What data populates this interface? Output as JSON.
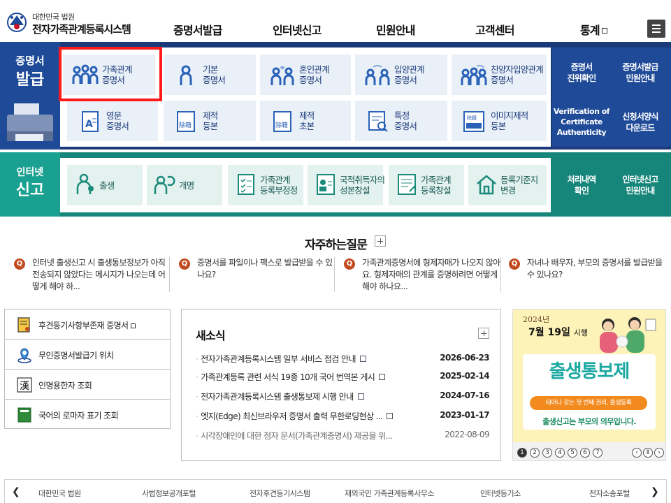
{
  "header": {
    "org": "대한민국 법원",
    "site_title": "전자가족관계등록시스템",
    "nav": [
      "증명서발급",
      "인터넷신고",
      "민원안내",
      "고객센터",
      "통계"
    ]
  },
  "issuance": {
    "title_top": "증명서",
    "title_bottom": "발급",
    "cards": [
      {
        "label": "가족관계\n증명서",
        "icon": "family-icon"
      },
      {
        "label": "기본\n증명서",
        "icon": "person-icon"
      },
      {
        "label": "혼인관계\n증명서",
        "icon": "couple-heart-icon"
      },
      {
        "label": "입양관계\n증명서",
        "icon": "adoption-icon"
      },
      {
        "label": "친양자입양관계\n증명서",
        "icon": "family-adoption-icon"
      },
      {
        "label": "영문\n증명서",
        "icon": "english-doc-icon"
      },
      {
        "label": "제적\n등본",
        "icon": "removed-record-icon"
      },
      {
        "label": "제적\n초본",
        "icon": "removed-record-icon"
      },
      {
        "label": "특정\n증명서",
        "icon": "search-doc-icon"
      },
      {
        "label": "이미지제적\n등본",
        "icon": "image-record-icon"
      }
    ],
    "side": [
      "증명서\n진위확인",
      "증명서발급\n민원안내",
      "Verification of\nCertificate\nAuthenticity",
      "신청서양식\n다운로드"
    ]
  },
  "report": {
    "title_top": "인터넷",
    "title_bottom": "신고",
    "cards": [
      {
        "label": "출생",
        "icon": "birth-icon"
      },
      {
        "label": "개명",
        "icon": "rename-icon"
      },
      {
        "label": "가족관계\n등록부정정",
        "icon": "checklist-icon"
      },
      {
        "label": "국적취득자의\n성본창설",
        "icon": "id-card-icon"
      },
      {
        "label": "가족관계\n등록창설",
        "icon": "create-doc-icon"
      },
      {
        "label": "등록기준지\n변경",
        "icon": "house-icon"
      }
    ],
    "side": [
      "처리내역\n확인",
      "인터넷신고\n민원안내"
    ]
  },
  "faq": {
    "title": "자주하는질문",
    "items": [
      "인터넷 출생신고 시 출생통보정보가 아직 전송되지 않았다는 메시지가 나오는데 어떻게 해야 하...",
      "증명서를 파일이나 팩스로 발급받을 수 있나요?",
      "가족관계증명서에 형제자매가 나오지 않아요. 형제자매의 관계를 증명하려면 어떻게 해야 하나요...",
      "자녀나 배우자, 부모의 증명서를 발급받을 수 있나요?"
    ]
  },
  "quick_links": [
    {
      "label": "후견등기사항부존재 증명서",
      "icon": "certificate-icon",
      "external": true
    },
    {
      "label": "무인증명서발급기 위치",
      "icon": "location-pin-icon",
      "external": false
    },
    {
      "label": "인명용한자 조회",
      "icon": "hanja-icon",
      "external": false
    },
    {
      "label": "국어의 로마자 표기 조회",
      "icon": "book-icon",
      "external": false
    }
  ],
  "news": {
    "title": "새소식",
    "items": [
      {
        "title": "전자가족관계등록시스템 일부 서비스 점검 안내",
        "date": "2026-06-23",
        "attach": true
      },
      {
        "title": "가족관계등록 관련 서식 19종 10개 국어 번역본 게시",
        "date": "2025-02-14",
        "attach": true
      },
      {
        "title": "전자가족관계등록시스템 출생통보제 시행 안내",
        "date": "2024-07-16",
        "attach": true
      },
      {
        "title": "엣지(Edge) 최신브라우저 증명서 출력 무한로딩현상 ...",
        "date": "2023-01-17",
        "attach": true
      },
      {
        "title": "시각장애인에 대한 점자 문서(가족관계증명서) 제공을 위...",
        "date": "2022-08-09",
        "attach": false
      }
    ]
  },
  "banner": {
    "year": "2024년",
    "date": "7월 19일",
    "date_suffix": "시행",
    "headline": "출생통보제",
    "ribbon": "태어나 갖는 첫 번째 권리, 출생등록",
    "footer": "출생신고는 부모의 의무입니다.",
    "pages": [
      "1",
      "2",
      "3",
      "4",
      "5",
      "6",
      "7"
    ],
    "active_page": "1"
  },
  "footer_links": [
    "대한민국 법원",
    "사법정보공개포털",
    "전자후견등기시스템",
    "재외국민 가족관계등록사무소",
    "인터넷등기소",
    "전자소송포털"
  ],
  "colors": {
    "issuance_band": "#1a3a7a",
    "report_band": "#16857a",
    "highlight": "#ff1a1a",
    "faq_q": "#c24a1f"
  }
}
